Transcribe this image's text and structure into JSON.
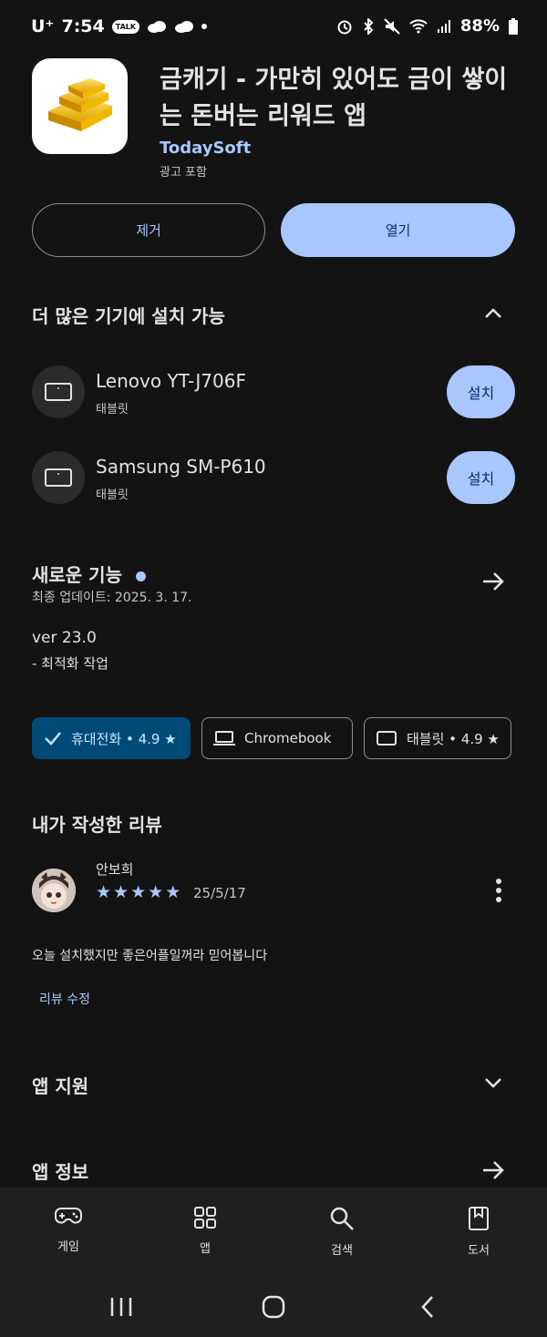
{
  "status_bar": {
    "carrier": "U⁺",
    "time": "7:54",
    "talk": "TALK",
    "battery": "88%"
  },
  "app": {
    "title": "금캐기 - 가만히 있어도 금이 쌓이는 돈버는 리워드 앱",
    "developer": "TodaySoft",
    "ad_note": "광고 포함",
    "remove_label": "제거",
    "open_label": "열기",
    "icon": "gold-bars-icon"
  },
  "devices_section": {
    "title": "더 많은 기기에 설치 가능",
    "devices": [
      {
        "name": "Lenovo YT-J706F",
        "type": "태블릿",
        "action": "설치"
      },
      {
        "name": "Samsung SM-P610",
        "type": "태블릿",
        "action": "설치"
      }
    ]
  },
  "whats_new": {
    "title": "새로운 기능",
    "updated": "최종 업데이트: 2025. 3. 17.",
    "version": "ver 23.0",
    "note": "- 최적화 작업"
  },
  "rating_chips": [
    {
      "label": "휴대전화 • 4.9 ★",
      "selected": true,
      "icon": "check-icon"
    },
    {
      "label": "Chromebook",
      "selected": false,
      "icon": "laptop-icon"
    },
    {
      "label": "태블릿 • 4.9 ★",
      "selected": false,
      "icon": "tablet-icon"
    }
  ],
  "my_review": {
    "title": "내가 작성한 리뷰",
    "author": "안보희",
    "stars": 5,
    "date": "25/5/17",
    "text": "오늘 설치했지만 좋은어플일꺼라 믿어봅니다",
    "edit_label": "리뷰 수정"
  },
  "app_support": {
    "title": "앱 지원"
  },
  "app_info": {
    "title": "앱 정보"
  },
  "bottom_nav": [
    {
      "label": "게임",
      "icon": "gamepad-icon"
    },
    {
      "label": "앱",
      "icon": "apps-grid-icon"
    },
    {
      "label": "검색",
      "icon": "search-icon"
    },
    {
      "label": "도서",
      "icon": "book-icon"
    }
  ],
  "colors": {
    "background": "#131314",
    "accent": "#a8c7fa",
    "chip_selected": "#004a77",
    "star": "#a8c7fa"
  }
}
